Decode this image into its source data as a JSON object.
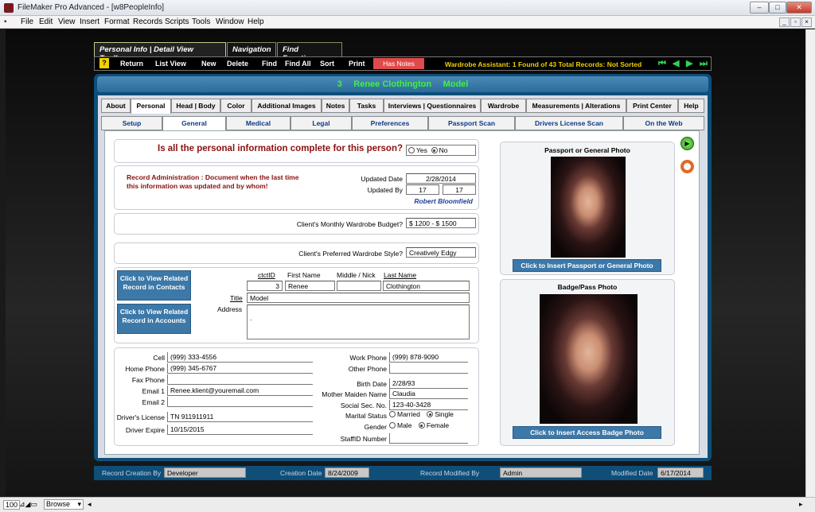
{
  "window": {
    "title": "FileMaker Pro Advanced - [w8PeopleInfo]",
    "btn_min": "–",
    "btn_max": "□",
    "btn_close": "✕"
  },
  "menu": [
    "File",
    "Edit",
    "View",
    "Insert",
    "Format",
    "Records",
    "Scripts",
    "Tools",
    "Window",
    "Help"
  ],
  "toolbar_tabs": {
    "active": "Personal Info | Detail View Toolbar",
    "navigation": "Navigation",
    "find": "Find Functions"
  },
  "toolbar": {
    "help": "?",
    "buttons": [
      "Return",
      "List View",
      "New",
      "Delete",
      "Find",
      "Find All",
      "Sort",
      "Print"
    ],
    "has_notes": "Has Notes",
    "wardrobe_assistant": "Wardrobe Assistant:  1 Found of 43 Total Records: Not Sorted"
  },
  "header": {
    "id": "3",
    "name": "Renee Clothington",
    "role": "Model"
  },
  "tabs_main": [
    "About",
    "Personal",
    "Head | Body",
    "Color",
    "Additional Images",
    "Notes",
    "Tasks",
    "Interviews | Questionnaires",
    "Wardrobe",
    "Measurements | Alterations",
    "Print Center",
    "Help"
  ],
  "tabs_sub": [
    "Setup",
    "General",
    "Medical",
    "Legal",
    "Preferences",
    "Passport Scan",
    "Drivers License Scan",
    "On the Web"
  ],
  "general": {
    "complete_question": "Is all the personal information complete for this person?",
    "yes": "Yes",
    "no": "No",
    "record_admin": "Record Administration : Document when the last time this information was updated and by whom!",
    "updated_date_label": "Updated Date",
    "updated_date": "2/28/2014",
    "updated_by_label": "Updated By",
    "updated_by_1": "17",
    "updated_by_2": "17",
    "updated_by_name": "Robert Bloomfield",
    "budget_label": "Client's Monthly Wardrobe Budget?",
    "budget": "$ 1200 - $ 1500",
    "style_label": "Client's  Preferred Wardrobe Style?",
    "style": "Creatively Edgy"
  },
  "contact": {
    "btn_contacts": "Click to View Related Record in Contacts",
    "btn_accounts": "Click to View Related Record in Accounts",
    "ctctid_label": "ctctID",
    "first_label": "First Name",
    "middle_label": "Middle / Nick",
    "last_label": "Last Name",
    "ctctid": "3",
    "first": "Renee",
    "middle": "",
    "last": "Clothington",
    "title_label": "Title",
    "title": "Model",
    "address_label": "Address",
    "address": "."
  },
  "details_left": {
    "cell_label": "Cell",
    "cell": "(999) 333-4556",
    "home_label": "Home Phone",
    "home": "(999) 345-6767",
    "fax_label": "Fax Phone",
    "fax": "",
    "email1_label": "Email 1",
    "email1": "Renee.klient@youremail.com",
    "email2_label": "Email 2",
    "email2": "",
    "dl_label": "Driver's License",
    "dl": "TN 911911911",
    "dl_exp_label": "Driver Expire",
    "dl_exp": "10/15/2015"
  },
  "details_right": {
    "work_label": "Work Phone",
    "work": "(999) 878-9090",
    "other_label": "Other Phone",
    "other": "",
    "birth_label": "Birth Date",
    "birth": "2/28/93",
    "maiden_label": "Mother Maiden Name",
    "maiden": "Claudia",
    "ssn_label": "Social Sec. No.",
    "ssn": "123-40-3428",
    "marital_label": "Marital Status",
    "married": "Married",
    "single": "Single",
    "gender_label": "Gender",
    "male": "Male",
    "female": "Female",
    "staffid_label": "StaffID Number",
    "staffid": ""
  },
  "photos": {
    "passport_title": "Passport or General Photo",
    "passport_btn": "Click to Insert Passport or General Photo",
    "badge_title": "Badge/Pass Photo",
    "badge_btn": "Click to Insert Access Badge Photo"
  },
  "status": {
    "creation_by_label": "Record Creation By",
    "creation_by": "Developer",
    "creation_date_label": "Creation Date",
    "creation_date": "8/24/2009",
    "modified_by_label": "Record Modified By",
    "modified_by": "Admin",
    "modified_date_label": "Modified Date",
    "modified_date": "6/17/2014"
  },
  "bottom": {
    "zoom": "100",
    "mode": "Browse"
  }
}
